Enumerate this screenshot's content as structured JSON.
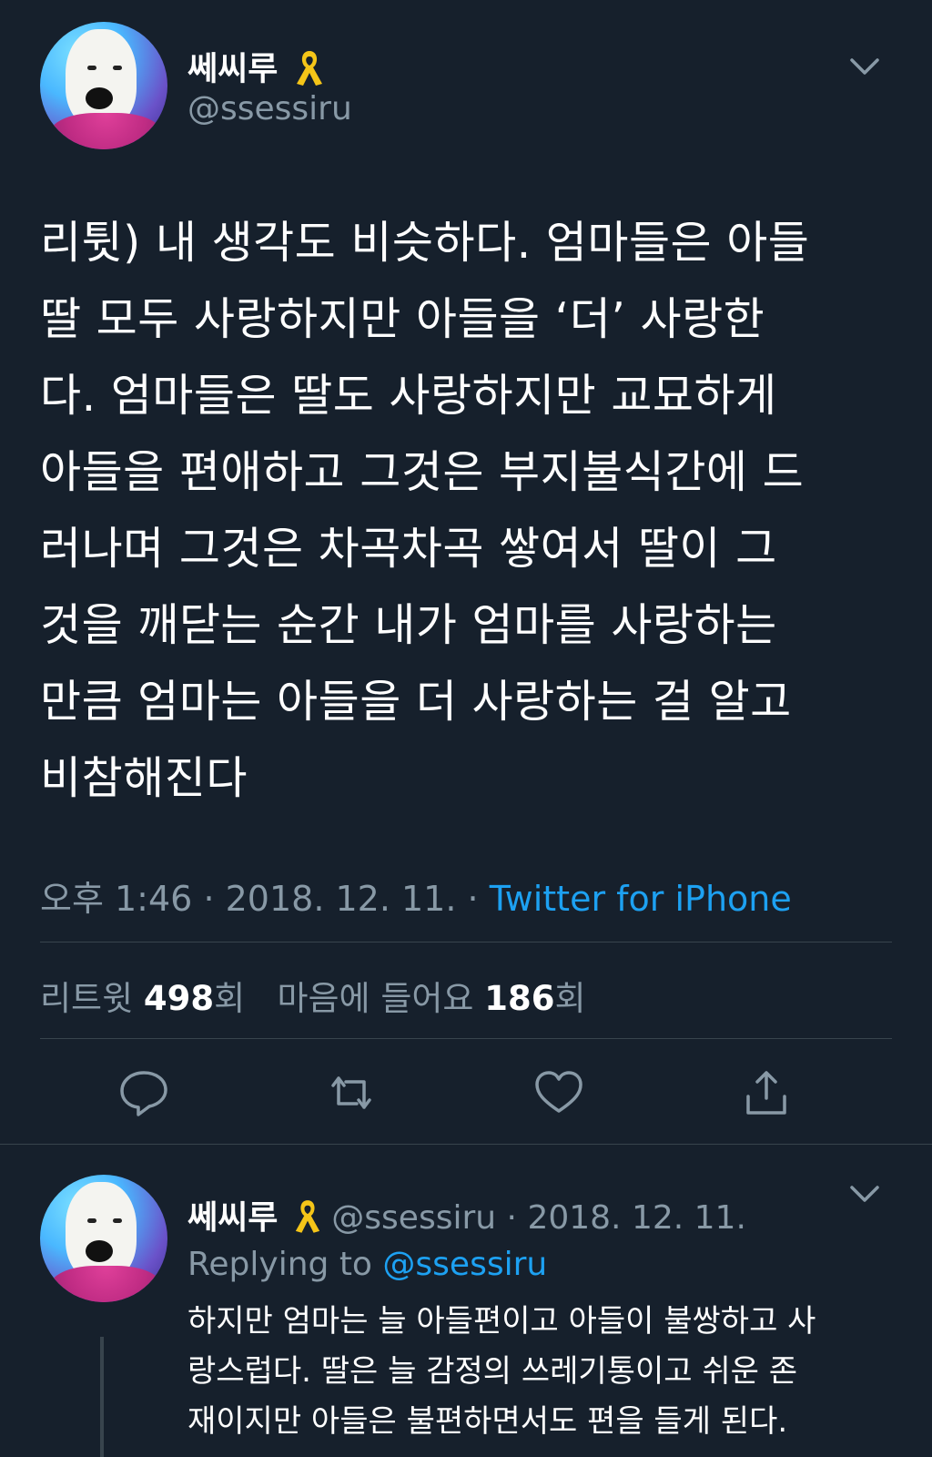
{
  "tweet": {
    "author": {
      "name": "쎄씨루",
      "handle": "@ssessiru",
      "ribbon_icon": "yellow-ribbon-icon"
    },
    "text": "리튓) 내 생각도 비슷하다. 엄마들은 아들\n딸 모두 사랑하지만 아들을 ‘더’ 사랑한\n다. 엄마들은 딸도 사랑하지만 교묘하게\n아들을 편애하고 그것은 부지불식간에 드\n러나며 그것은 차곡차곡 쌓여서 딸이 그\n것을 깨닫는 순간 내가 엄마를 사랑하는\n만큼 엄마는 아들을 더 사랑하는 걸 알고\n비참해진다",
    "time": "오후 1:46",
    "date": "2018. 12. 11.",
    "separator": "·",
    "source": "Twitter for iPhone",
    "stats": {
      "retweets_label": "리트윗",
      "retweets_count": "498",
      "retweets_suffix": "회",
      "likes_label": "마음에 들어요",
      "likes_count": "186",
      "likes_suffix": "회"
    },
    "actions": [
      "reply-icon",
      "retweet-icon",
      "like-icon",
      "share-icon"
    ]
  },
  "reply": {
    "author": {
      "name": "쎄씨루",
      "handle": "@ssessiru",
      "date": "2018. 12. 11."
    },
    "separator": "·",
    "replying_label": "Replying to",
    "replying_handle": "@ssessiru",
    "text": "하지만 엄마는 늘 아들편이고 아들이 불쌍하고 사\n랑스럽다. 딸은 늘 감정의 쓰레기통이고 쉬운 존\n재이지만 아들은 불편하면서도 편을 들게 된다."
  },
  "colors": {
    "background": "#16202c",
    "secondary_text": "#8899a6",
    "link": "#1da1f2",
    "divider": "#38444d",
    "ribbon": "#f5c518"
  }
}
